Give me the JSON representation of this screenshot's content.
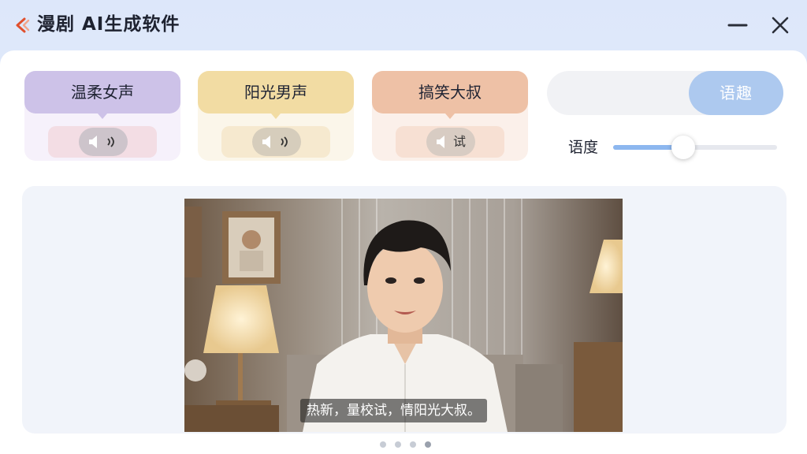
{
  "window": {
    "title": "漫剧 AI生成软件",
    "accent_color": "#e0502e"
  },
  "voices": [
    {
      "label": "温柔女声",
      "preview_icon": "speaker-wave-icon",
      "preview_label": "",
      "color": "#cdc2e8"
    },
    {
      "label": "阳光男声",
      "preview_icon": "speaker-wave-icon",
      "preview_label": "",
      "color": "#f2dca3"
    },
    {
      "label": "搞笑大叔",
      "preview_icon": "speaker-icon",
      "preview_label": "试",
      "color": "#eec1a6"
    }
  ],
  "generate": {
    "label": "语趣",
    "color": "#adc9ef"
  },
  "speed": {
    "label": "语度",
    "value": 0.43
  },
  "video": {
    "subtitle": "热新，量校试，情阳光大叔。"
  },
  "pager": {
    "count": 4,
    "active_index": 3
  }
}
